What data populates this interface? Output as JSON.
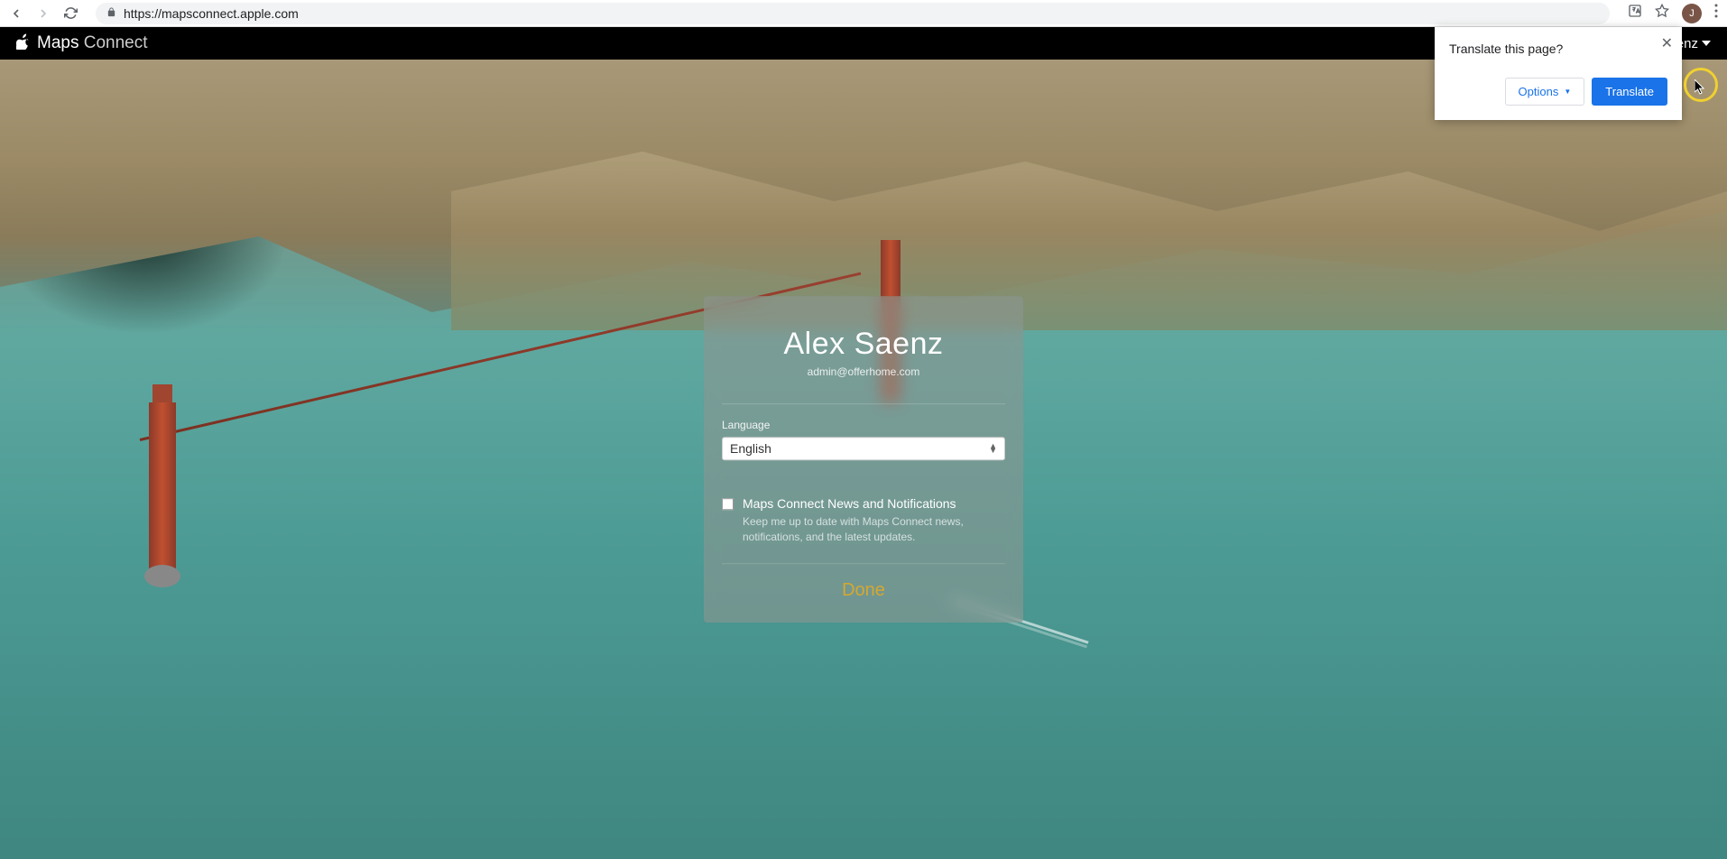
{
  "browser": {
    "url": "https://mapsconnect.apple.com",
    "avatar_initial": "J"
  },
  "header": {
    "brand_bold": "Maps",
    "brand_light": "Connect",
    "user_partial": "aenz"
  },
  "modal": {
    "name": "Alex Saenz",
    "email": "admin@offerhome.com",
    "language_label": "Language",
    "language_value": "English",
    "news_title": "Maps Connect News and Notifications",
    "news_desc": "Keep me up to date with Maps Connect news, notifications, and the latest updates.",
    "done_label": "Done"
  },
  "translate": {
    "title": "Translate this page?",
    "options_label": "Options",
    "translate_label": "Translate"
  }
}
